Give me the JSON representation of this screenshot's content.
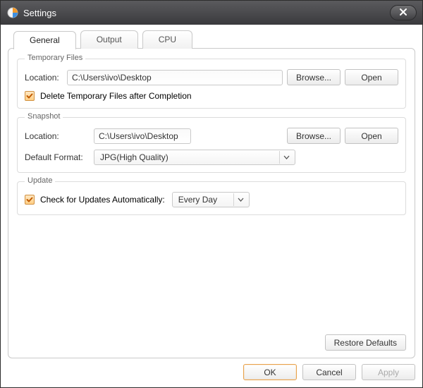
{
  "window": {
    "title": "Settings"
  },
  "tabs": {
    "general": "General",
    "output": "Output",
    "cpu": "CPU"
  },
  "groups": {
    "temp": {
      "legend": "Temporary Files",
      "location_label": "Location:",
      "location_value": "C:\\Users\\ivo\\Desktop",
      "browse": "Browse...",
      "open": "Open",
      "delete_temp_label": "Delete Temporary Files after Completion"
    },
    "snapshot": {
      "legend": "Snapshot",
      "location_label": "Location:",
      "location_value": "C:\\Users\\ivo\\Desktop",
      "browse": "Browse...",
      "open": "Open",
      "format_label": "Default Format:",
      "format_value": "JPG(High Quality)"
    },
    "update": {
      "legend": "Update",
      "check_label": "Check for Updates Automatically:",
      "frequency_value": "Every Day"
    }
  },
  "buttons": {
    "restore_defaults": "Restore Defaults",
    "ok": "OK",
    "cancel": "Cancel",
    "apply": "Apply"
  }
}
